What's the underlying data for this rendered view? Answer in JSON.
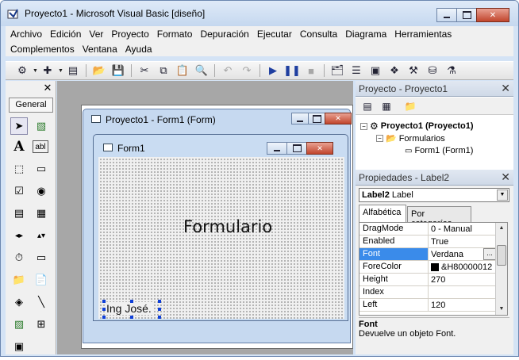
{
  "window": {
    "title": "Proyecto1 - Microsoft Visual Basic [diseño]",
    "min_label": "",
    "close_label": "✕"
  },
  "menu": {
    "row1": [
      "Archivo",
      "Edición",
      "Ver",
      "Proyecto",
      "Formato",
      "Depuración",
      "Ejecutar",
      "Consulta",
      "Diagrama",
      "Herramientas"
    ],
    "row2": [
      "Complementos",
      "Ventana",
      "Ayuda"
    ]
  },
  "toolbox": {
    "tab": "General",
    "close": "✕"
  },
  "form_designer": {
    "title": "Proyecto1 - Form1 (Form)"
  },
  "form1": {
    "title": "Form1",
    "label1": "Formulario",
    "label2": "Ing José."
  },
  "project_panel": {
    "title": "Proyecto - Proyecto1",
    "close": "✕",
    "tree": {
      "root": "Proyecto1 (Proyecto1)",
      "folder": "Formularios",
      "item": "Form1 (Form1)"
    }
  },
  "properties_panel": {
    "title": "Propiedades - Label2",
    "close": "✕",
    "object_name": "Label2",
    "object_type": "Label",
    "tabs": [
      "Alfabética",
      "Por categorías"
    ],
    "rows": [
      {
        "name": "DragMode",
        "value": "0 - Manual"
      },
      {
        "name": "Enabled",
        "value": "True"
      },
      {
        "name": "Font",
        "value": "Verdana"
      },
      {
        "name": "ForeColor",
        "value": "&H80000012"
      },
      {
        "name": "Height",
        "value": "270"
      },
      {
        "name": "Index",
        "value": ""
      },
      {
        "name": "Left",
        "value": "120"
      }
    ],
    "ellipsis": "...",
    "desc_title": "Font",
    "desc_text": "Devuelve un objeto Font."
  },
  "colors": {
    "selection": "#3a8bea",
    "close_button": "#c1452c",
    "mdi_background": "#a7a7a7"
  }
}
